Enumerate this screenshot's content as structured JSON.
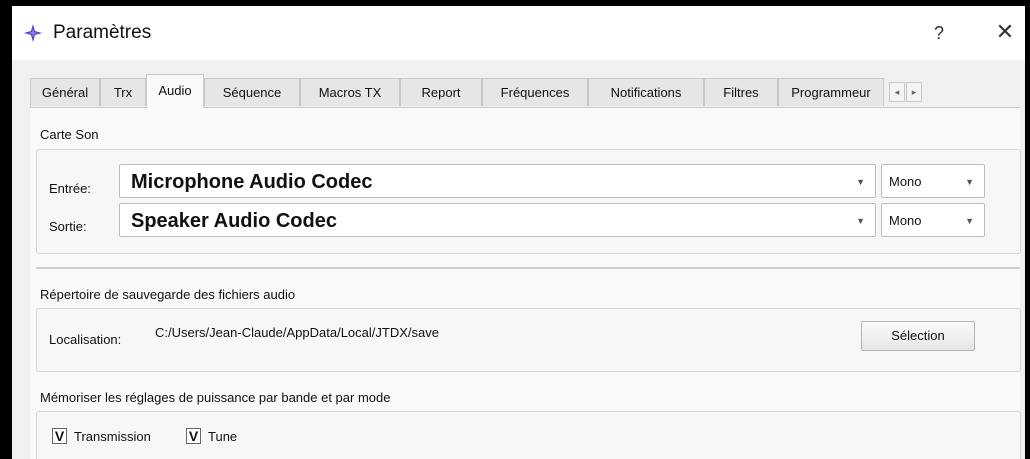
{
  "window": {
    "title": "Paramètres",
    "help_label": "?",
    "close_label": "✕",
    "icon": "star-app-icon",
    "accent": "#5a3fc9"
  },
  "tabs": [
    {
      "label": "Général",
      "active": false
    },
    {
      "label": "Trx",
      "active": false
    },
    {
      "label": "Audio",
      "active": true
    },
    {
      "label": "Séquence",
      "active": false
    },
    {
      "label": "Macros TX",
      "active": false
    },
    {
      "label": "Report",
      "active": false
    },
    {
      "label": "Fréquences",
      "active": false
    },
    {
      "label": "Notifications",
      "active": false
    },
    {
      "label": "Filtres",
      "active": false
    },
    {
      "label": "Programmeur",
      "active": false
    }
  ],
  "tab_scroll": {
    "left": "◂",
    "right": "▸"
  },
  "sound_card": {
    "heading": "Carte Son",
    "input_label": "Entrée:",
    "input_value": "Microphone Audio Codec",
    "input_channel": "Mono",
    "output_label": "Sortie:",
    "output_value": "Speaker Audio Codec",
    "output_channel": "Mono",
    "dropdown_glyph": "▼"
  },
  "save_dir": {
    "heading": "Répertoire de sauvegarde des fichiers audio",
    "location_label": "Localisation:",
    "path": "C:/Users/Jean-Claude/AppData/Local/JTDX/save",
    "select_button": "Sélection"
  },
  "power": {
    "heading": "Mémoriser les réglages de puissance par bande et par mode",
    "transmission_label": "Transmission",
    "transmission_checked": true,
    "tune_label": "Tune",
    "tune_checked": true,
    "check_mark": "V"
  }
}
